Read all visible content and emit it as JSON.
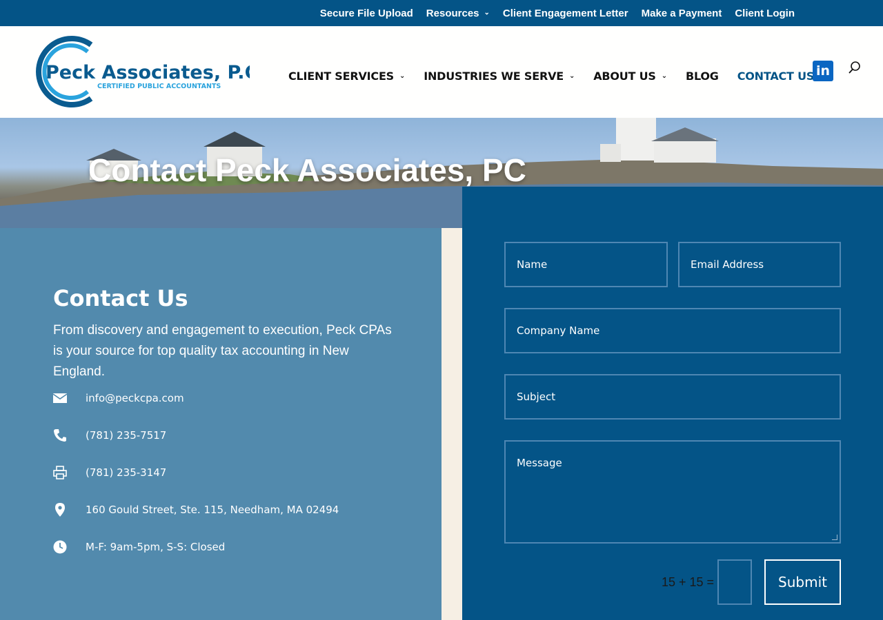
{
  "topbar": {
    "links": [
      {
        "label": "Secure File Upload",
        "has_chevron": false
      },
      {
        "label": "Resources",
        "has_chevron": true
      },
      {
        "label": "Client Engagement Letter",
        "has_chevron": false
      },
      {
        "label": "Make a Payment",
        "has_chevron": false
      },
      {
        "label": "Client Login",
        "has_chevron": false
      }
    ]
  },
  "header": {
    "logo": {
      "name": "Peck Associates, P.C.",
      "tagline": "CERTIFIED PUBLIC ACCOUNTANTS"
    },
    "nav": [
      {
        "label": "CLIENT SERVICES",
        "has_chevron": true,
        "active": false
      },
      {
        "label": "INDUSTRIES WE SERVE",
        "has_chevron": true,
        "active": false
      },
      {
        "label": "ABOUT US",
        "has_chevron": true,
        "active": false
      },
      {
        "label": "BLOG",
        "has_chevron": false,
        "active": false
      },
      {
        "label": "CONTACT US",
        "has_chevron": false,
        "active": true
      }
    ],
    "social_icon": "linkedin-icon",
    "linkedin_text": "in",
    "search_icon": "search-icon"
  },
  "hero": {
    "title": "Contact Peck Associates, PC"
  },
  "contact": {
    "heading": "Contact Us",
    "description": "From discovery and engagement to execution, Peck CPAs is your source for top quality tax accounting in New England.",
    "items": [
      {
        "icon": "envelope-icon",
        "text": "info@peckcpa.com"
      },
      {
        "icon": "phone-icon",
        "text": "(781) 235-7517"
      },
      {
        "icon": "printer-icon",
        "text": "(781) 235-3147"
      },
      {
        "icon": "map-pin-icon",
        "text": "160 Gould Street, Ste. 115, Needham, MA 02494"
      },
      {
        "icon": "clock-icon",
        "text": "M-F: 9am-5pm, S-S: Closed"
      }
    ]
  },
  "form": {
    "name_placeholder": "Name",
    "email_placeholder": "Email Address",
    "company_placeholder": "Company Name",
    "subject_placeholder": "Subject",
    "message_placeholder": "Message",
    "captcha_question": "15 + 15 =",
    "submit_label": "Submit"
  },
  "colors": {
    "brand_dark_blue": "#045487",
    "panel_blue": "#528aad",
    "field_border": "#4f87b3",
    "active_nav": "#045487",
    "cream": "#f6efe4"
  }
}
